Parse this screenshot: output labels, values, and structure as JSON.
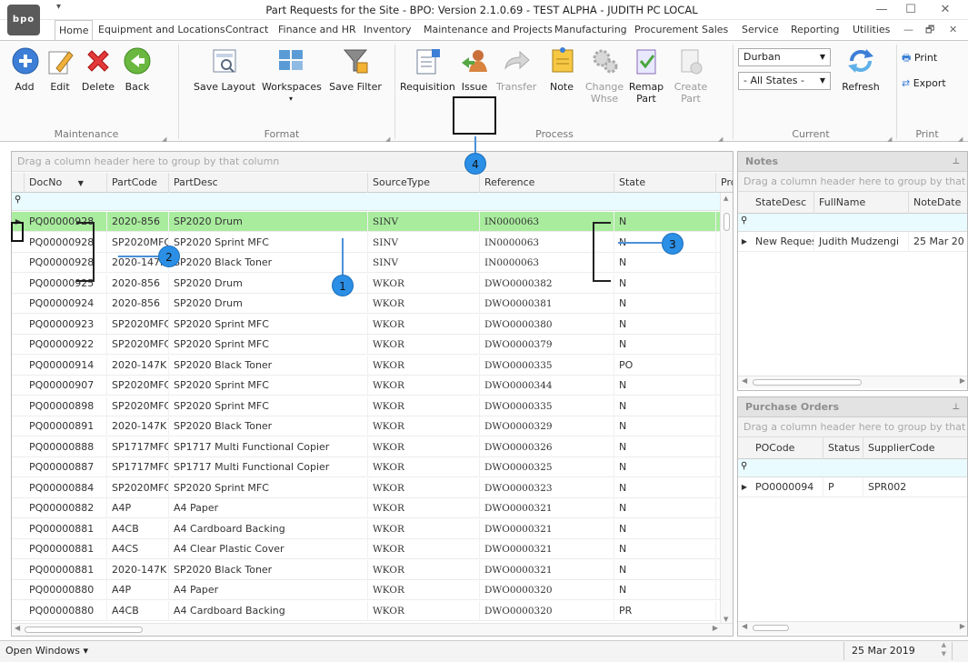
{
  "window": {
    "title": "Part Requests for the Site - BPO: Version 2.1.0.69 - TEST ALPHA - JUDITH PC LOCAL",
    "logo_text": "bpo",
    "minimize": "—",
    "maximize": "☐",
    "close": "✕"
  },
  "tabs": [
    {
      "label": "Home",
      "active": true
    },
    {
      "label": "Equipment and Locations"
    },
    {
      "label": "Contract"
    },
    {
      "label": "Finance and HR"
    },
    {
      "label": "Inventory"
    },
    {
      "label": "Maintenance and Projects"
    },
    {
      "label": "Manufacturing"
    },
    {
      "label": "Procurement"
    },
    {
      "label": "Sales"
    },
    {
      "label": "Service"
    },
    {
      "label": "Reporting"
    },
    {
      "label": "Utilities"
    }
  ],
  "ribbon": {
    "maintenance": {
      "label": "Maintenance",
      "add": "Add",
      "edit": "Edit",
      "delete": "Delete",
      "back": "Back"
    },
    "format": {
      "label": "Format",
      "save_layout": "Save Layout",
      "workspaces": "Workspaces",
      "save_filter": "Save Filter"
    },
    "process": {
      "label": "Process",
      "requisition": "Requisition",
      "issue": "Issue",
      "transfer": "Transfer",
      "note": "Note",
      "change_whse_1": "Change",
      "change_whse_2": "Whse",
      "remap_part_1": "Remap",
      "remap_part_2": "Part",
      "create_part_1": "Create",
      "create_part_2": "Part"
    },
    "current": {
      "label": "Current",
      "site": "Durban",
      "states": "- All States -",
      "refresh": "Refresh"
    },
    "print": {
      "label": "Print",
      "print": "Print",
      "export": "Export"
    }
  },
  "grid": {
    "group_hint": "Drag a column header here to group by that column",
    "columns": [
      "DocNo",
      "PartCode",
      "PartDesc",
      "SourceType",
      "Reference",
      "State",
      "Prd"
    ],
    "rows": [
      [
        "PQ00000928",
        "2020-856",
        "SP2020 Drum",
        "SINV",
        "IN0000063",
        "N"
      ],
      [
        "PQ00000928",
        "SP2020MFC",
        "SP2020 Sprint MFC",
        "SINV",
        "IN0000063",
        "N"
      ],
      [
        "PQ00000928",
        "2020-147K",
        "SP2020 Black Toner",
        "SINV",
        "IN0000063",
        "N"
      ],
      [
        "PQ00000925",
        "2020-856",
        "SP2020 Drum",
        "WKOR",
        "DWO0000382",
        "N"
      ],
      [
        "PQ00000924",
        "2020-856",
        "SP2020 Drum",
        "WKOR",
        "DWO0000381",
        "N"
      ],
      [
        "PQ00000923",
        "SP2020MFC",
        "SP2020 Sprint MFC",
        "WKOR",
        "DWO0000380",
        "N"
      ],
      [
        "PQ00000922",
        "SP2020MFC",
        "SP2020 Sprint MFC",
        "WKOR",
        "DWO0000379",
        "N"
      ],
      [
        "PQ00000914",
        "2020-147K",
        "SP2020 Black Toner",
        "WKOR",
        "DWO0000335",
        "PO"
      ],
      [
        "PQ00000907",
        "SP2020MFC",
        "SP2020 Sprint MFC",
        "WKOR",
        "DWO0000344",
        "N"
      ],
      [
        "PQ00000898",
        "SP2020MFC",
        "SP2020 Sprint MFC",
        "WKOR",
        "DWO0000335",
        "N"
      ],
      [
        "PQ00000891",
        "2020-147K",
        "SP2020 Black Toner",
        "WKOR",
        "DWO0000329",
        "N"
      ],
      [
        "PQ00000888",
        "SP1717MFC",
        "SP1717 Multi Functional Copier",
        "WKOR",
        "DWO0000326",
        "N"
      ],
      [
        "PQ00000887",
        "SP1717MFC",
        "SP1717 Multi Functional Copier",
        "WKOR",
        "DWO0000325",
        "N"
      ],
      [
        "PQ00000884",
        "SP2020MFC",
        "SP2020 Sprint MFC",
        "WKOR",
        "DWO0000323",
        "N"
      ],
      [
        "PQ00000882",
        "A4P",
        "A4 Paper",
        "WKOR",
        "DWO0000321",
        "N"
      ],
      [
        "PQ00000881",
        "A4CB",
        "A4 Cardboard Backing",
        "WKOR",
        "DWO0000321",
        "N"
      ],
      [
        "PQ00000881",
        "A4CS",
        "A4 Clear Plastic Cover",
        "WKOR",
        "DWO0000321",
        "N"
      ],
      [
        "PQ00000881",
        "2020-147K",
        "SP2020 Black Toner",
        "WKOR",
        "DWO0000321",
        "N"
      ],
      [
        "PQ00000880",
        "A4P",
        "A4 Paper",
        "WKOR",
        "DWO0000320",
        "N"
      ],
      [
        "PQ00000880",
        "A4CB",
        "A4 Cardboard Backing",
        "WKOR",
        "DWO0000320",
        "PR"
      ]
    ]
  },
  "notes": {
    "title": "Notes",
    "group_hint": "Drag a column header here to group by that column",
    "columns": [
      "StateDesc",
      "FullName",
      "NoteDate"
    ],
    "row": [
      "New Request",
      "Judith Mudzengi",
      "25 Mar 20"
    ]
  },
  "purchase_orders": {
    "title": "Purchase Orders",
    "group_hint": "Drag a column header here to group by that column",
    "columns": [
      "POCode",
      "Status",
      "SupplierCode"
    ],
    "row": [
      "PO0000094",
      "P",
      "SPR002"
    ]
  },
  "status": {
    "open_windows": "Open Windows ▾",
    "date": "25 Mar 2019"
  },
  "annotations": [
    "1",
    "2",
    "3",
    "4"
  ],
  "icons": {
    "filter_row": "filter-icon",
    "row_indicator": "row-pointer-icon"
  }
}
